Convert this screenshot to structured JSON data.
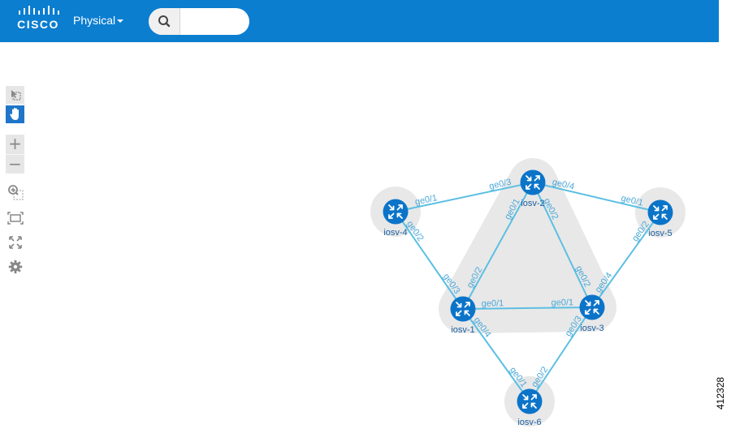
{
  "header": {
    "logo_text": "CISCO",
    "view_menu_label": "Physical",
    "search_value": ""
  },
  "toolbar": {
    "tools": [
      "select-icon",
      "pan-icon",
      "zoom-in-icon",
      "zoom-out-icon",
      "zoom-selection-icon",
      "fit-to-screen-icon",
      "fullscreen-icon",
      "gear-icon"
    ]
  },
  "topology": {
    "nodes": [
      {
        "id": "iosv-1",
        "label": "iosv-1"
      },
      {
        "id": "iosv-2",
        "label": "iosv-2"
      },
      {
        "id": "iosv-3",
        "label": "iosv-3"
      },
      {
        "id": "iosv-4",
        "label": "iosv-4"
      },
      {
        "id": "iosv-5",
        "label": "iosv-5"
      },
      {
        "id": "iosv-6",
        "label": "iosv-6"
      }
    ],
    "links": [
      {
        "from": "iosv-4",
        "to": "iosv-2",
        "from_port": "ge0/1",
        "to_port": "ge0/3"
      },
      {
        "from": "iosv-2",
        "to": "iosv-5",
        "from_port": "ge0/4",
        "to_port": "ge0/1"
      },
      {
        "from": "iosv-4",
        "to": "iosv-1",
        "from_port": "ge0/2",
        "to_port": "ge0/3"
      },
      {
        "from": "iosv-2",
        "to": "iosv-1",
        "from_port": "ge0/1",
        "to_port": "ge0/2"
      },
      {
        "from": "iosv-2",
        "to": "iosv-3",
        "from_port": "ge0/2",
        "to_port": "ge0/2"
      },
      {
        "from": "iosv-5",
        "to": "iosv-3",
        "from_port": "ge0/2",
        "to_port": "ge0/4"
      },
      {
        "from": "iosv-1",
        "to": "iosv-3",
        "from_port": "ge0/1",
        "to_port": "ge0/1"
      },
      {
        "from": "iosv-1",
        "to": "iosv-6",
        "from_port": "ge0/4",
        "to_port": "ge0/1"
      },
      {
        "from": "iosv-3",
        "to": "iosv-6",
        "from_port": "ge0/3",
        "to_port": "ge0/2"
      }
    ],
    "colors": {
      "link": "#5bbfe3",
      "port_label": "#4aa8d8",
      "node": "#0b74c9",
      "node_label": "#1a5fa0",
      "group": "#e8e8e8"
    }
  },
  "figure_id": "412328"
}
